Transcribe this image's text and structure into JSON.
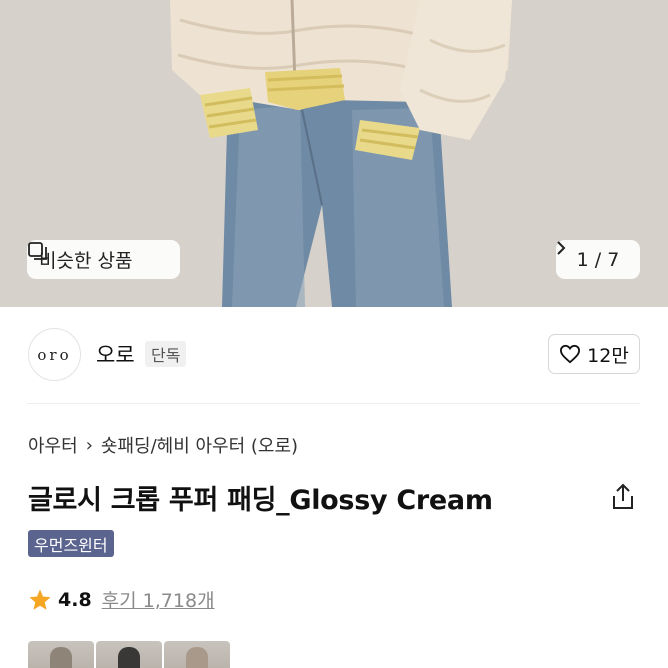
{
  "hero": {
    "similar_label": "비슷한 상품",
    "counter_current": "1",
    "counter_sep": "/",
    "counter_total": "7"
  },
  "brand": {
    "logo_text": "oro",
    "name": "오로",
    "tag": "단독",
    "likes": "12만"
  },
  "product": {
    "breadcrumb": [
      "아우터",
      "숏패딩/헤비 아우터 (오로)"
    ],
    "title": "글로시 크롭 푸퍼 패딩_Glossy Cream",
    "label": "우먼즈윈터",
    "rating": "4.8",
    "reviews": "후기 1,718개"
  },
  "colors": {
    "star": "#f5a623",
    "label_bg": "#5b638f"
  },
  "icons": [
    "similar-items-icon",
    "chevron-right-icon",
    "heart-icon",
    "share-icon",
    "star-icon"
  ]
}
